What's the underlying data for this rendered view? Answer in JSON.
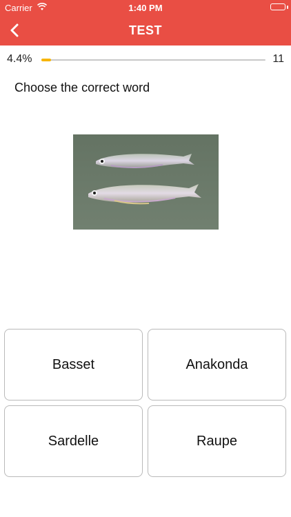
{
  "status": {
    "carrier": "Carrier",
    "time": "1:40 PM"
  },
  "navbar": {
    "title": "TEST",
    "back_icon": "chevron-left-icon"
  },
  "progress": {
    "percent_label": "4.4%",
    "fraction": 0.044,
    "count": "11"
  },
  "question": {
    "instruction": "Choose the correct word"
  },
  "answers": [
    {
      "label": "Basset"
    },
    {
      "label": "Anakonda"
    },
    {
      "label": "Sardelle"
    },
    {
      "label": "Raupe"
    }
  ],
  "colors": {
    "header": "#e94e44",
    "progress": "#f7b500"
  }
}
